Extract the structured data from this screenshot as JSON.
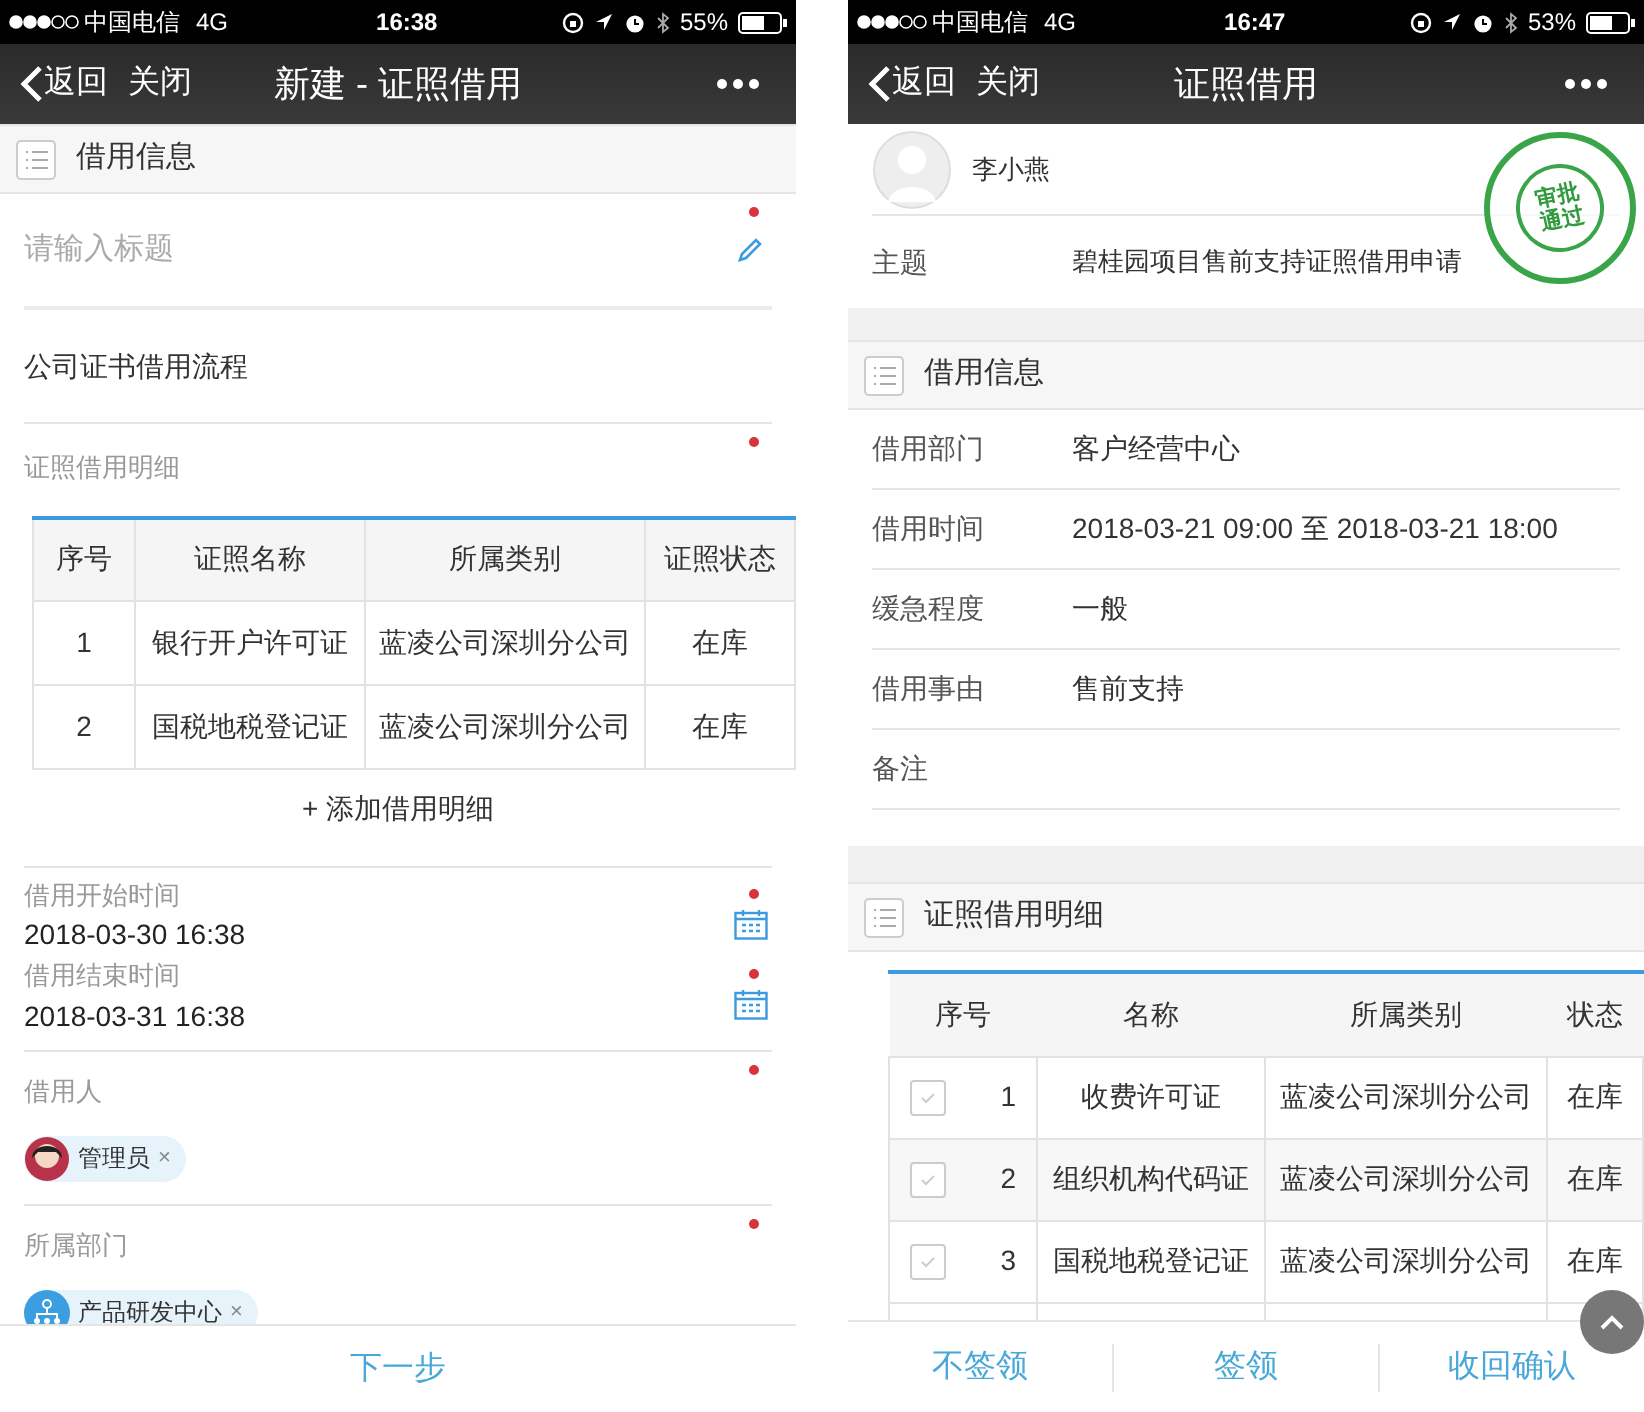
{
  "left": {
    "status_bar": {
      "carrier": "中国电信",
      "network": "4G",
      "time": "16:38",
      "battery": "55%"
    },
    "nav": {
      "back": "返回",
      "close": "关闭",
      "title": "新建 - 证照借用"
    },
    "section": "借用信息",
    "title_field": {
      "placeholder": "请输入标题",
      "required": true
    },
    "process": "公司证书借用流程",
    "detail": {
      "label": "证照借用明细",
      "required": true,
      "columns": [
        "序号",
        "证照名称",
        "所属类别",
        "证照状态"
      ],
      "rows": [
        [
          "1",
          "银行开户许可证",
          "蓝凌公司深圳分公司",
          "在库"
        ],
        [
          "2",
          "国税地税登记证",
          "蓝凌公司深圳分公司",
          "在库"
        ]
      ],
      "add": "+ 添加借用明细"
    },
    "dates": [
      {
        "label": "借用开始时间",
        "value": "2018-03-30 16:38",
        "required": true
      },
      {
        "label": "借用结束时间",
        "value": "2018-03-31 16:38",
        "required": true
      }
    ],
    "pickers": [
      {
        "label": "借用人",
        "required": true,
        "chip": {
          "kind": "person",
          "text": "管理员",
          "remove": "×"
        }
      },
      {
        "label": "所属部门",
        "required": true,
        "chip": {
          "kind": "department",
          "text": "产品研发中心",
          "remove": "×"
        }
      }
    ],
    "footer": [
      "下一步"
    ]
  },
  "right": {
    "status_bar": {
      "carrier": "中国电信",
      "network": "4G",
      "time": "16:47",
      "battery": "53%"
    },
    "nav": {
      "back": "返回",
      "close": "关闭",
      "title": "证照借用"
    },
    "applicant": "李小燕",
    "subject": {
      "label": "主题",
      "value": "碧桂园项目售前支持证照借用申请"
    },
    "stamp": [
      "审批",
      "通过"
    ],
    "info": {
      "section": "借用信息",
      "rows": [
        {
          "label": "借用部门",
          "value": "客户经营中心"
        },
        {
          "label": "借用时间",
          "value": "2018-03-21 09:00 至 2018-03-21 18:00"
        },
        {
          "label": "缓急程度",
          "value": "一般"
        },
        {
          "label": "借用事由",
          "value": "售前支持"
        },
        {
          "label": "备注"
        }
      ]
    },
    "detail": {
      "section": "证照借用明细",
      "columns": [
        "序号",
        "名称",
        "所属类别",
        "状态"
      ],
      "rows": [
        {
          "checked": false,
          "cells": [
            "1",
            "收费许可证",
            "蓝凌公司深圳分公司",
            "在库"
          ]
        },
        {
          "checked": false,
          "cells": [
            "2",
            "组织机构代码证",
            "蓝凌公司深圳分公司",
            "在库"
          ]
        },
        {
          "checked": false,
          "cells": [
            "3",
            "国税地税登记证",
            "蓝凌公司深圳分公司",
            "在库"
          ]
        }
      ]
    },
    "actions": [
      "不签领",
      "签领",
      "收回确认"
    ]
  }
}
